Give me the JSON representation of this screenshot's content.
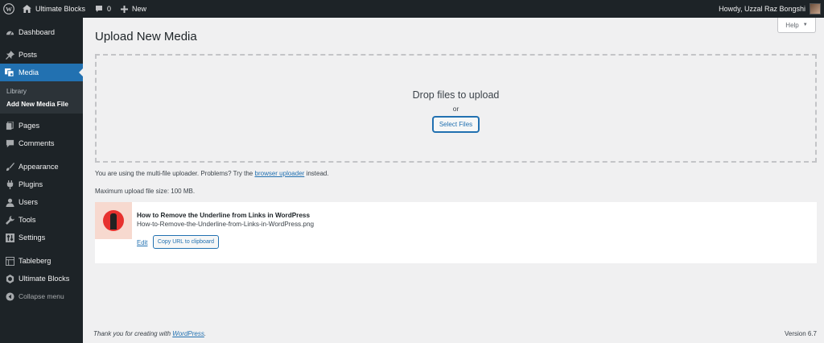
{
  "adminbar": {
    "site_name": "Ultimate Blocks",
    "comments_count": "0",
    "new_label": "New",
    "greeting": "Howdy, Uzzal Raz Bongshi"
  },
  "sidebar": {
    "items": [
      {
        "label": "Dashboard",
        "icon": "dashboard-icon"
      },
      {
        "label": "Posts",
        "icon": "pin-icon"
      },
      {
        "label": "Media",
        "icon": "media-icon"
      },
      {
        "label": "Pages",
        "icon": "pages-icon"
      },
      {
        "label": "Comments",
        "icon": "comment-icon"
      },
      {
        "label": "Appearance",
        "icon": "brush-icon"
      },
      {
        "label": "Plugins",
        "icon": "plugin-icon"
      },
      {
        "label": "Users",
        "icon": "user-icon"
      },
      {
        "label": "Tools",
        "icon": "wrench-icon"
      },
      {
        "label": "Settings",
        "icon": "settings-icon"
      },
      {
        "label": "Tableberg",
        "icon": "table-icon"
      },
      {
        "label": "Ultimate Blocks",
        "icon": "hexagon-icon"
      },
      {
        "label": "Collapse menu",
        "icon": "collapse-icon"
      }
    ],
    "media_submenu": [
      "Library",
      "Add New Media File"
    ]
  },
  "main": {
    "title": "Upload New Media",
    "help_label": "Help",
    "drop_title": "Drop files to upload",
    "drop_or": "or",
    "select_files": "Select Files",
    "uploader_note_before": "You are using the multi-file uploader. Problems? Try the",
    "uploader_link": "browser uploader",
    "uploader_note_after": "instead.",
    "max_size": "Maximum upload file size: 100 MB.",
    "media_item": {
      "title": "How to Remove the Underline from Links in WordPress",
      "filename": "How-to-Remove-the-Underline-from-Links-in-WordPress.png",
      "edit_label": "Edit",
      "copy_label": "Copy URL to clipboard"
    }
  },
  "footer": {
    "thanks_before": "Thank you for creating with",
    "thanks_link": "WordPress",
    "thanks_after": ".",
    "version": "Version 6.7"
  },
  "colors": {
    "accent": "#2271b1",
    "adminbar_bg": "#1d2327",
    "page_bg": "#f0f0f1"
  }
}
